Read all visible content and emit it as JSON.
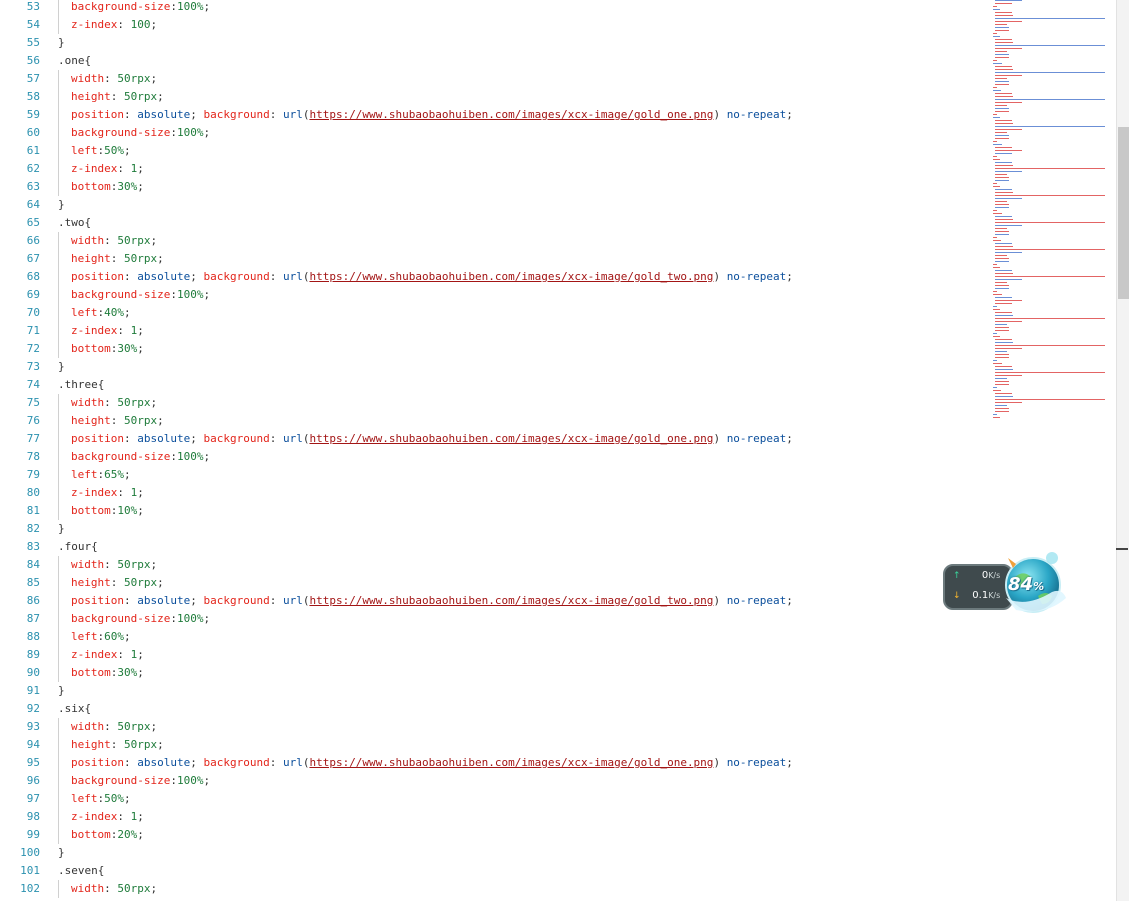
{
  "editor": {
    "lines": [
      {
        "n": "53",
        "indent": true,
        "tokens": [
          [
            "prop",
            "background-size"
          ],
          [
            "punct",
            ":"
          ],
          [
            "num",
            "100%"
          ],
          [
            "punct",
            ";"
          ]
        ]
      },
      {
        "n": "54",
        "indent": true,
        "tokens": [
          [
            "prop",
            "z-index"
          ],
          [
            "punct",
            ": "
          ],
          [
            "num",
            "100"
          ],
          [
            "punct",
            ";"
          ]
        ]
      },
      {
        "n": "55",
        "indent": false,
        "tokens": [
          [
            "brace",
            "}"
          ]
        ]
      },
      {
        "n": "56",
        "indent": false,
        "tokens": [
          [
            "sel",
            ".one"
          ],
          [
            "brace",
            "{"
          ]
        ]
      },
      {
        "n": "57",
        "indent": true,
        "tokens": [
          [
            "prop",
            "width"
          ],
          [
            "punct",
            ": "
          ],
          [
            "num",
            "50rpx"
          ],
          [
            "punct",
            ";"
          ]
        ]
      },
      {
        "n": "58",
        "indent": true,
        "tokens": [
          [
            "prop",
            "height"
          ],
          [
            "punct",
            ": "
          ],
          [
            "num",
            "50rpx"
          ],
          [
            "punct",
            ";"
          ]
        ]
      },
      {
        "n": "59",
        "indent": true,
        "tokens": [
          [
            "prop",
            "position"
          ],
          [
            "punct",
            ": "
          ],
          [
            "val",
            "absolute"
          ],
          [
            "punct",
            "; "
          ],
          [
            "prop",
            "background"
          ],
          [
            "punct",
            ": "
          ],
          [
            "fn",
            "url"
          ],
          [
            "punct",
            "("
          ],
          [
            "url",
            "https://www.shubaobaohuiben.com/images/xcx-image/gold_one.png"
          ],
          [
            "punct",
            ") "
          ],
          [
            "val",
            "no-repeat"
          ],
          [
            "punct",
            ";"
          ]
        ]
      },
      {
        "n": "60",
        "indent": true,
        "tokens": [
          [
            "prop",
            "background-size"
          ],
          [
            "punct",
            ":"
          ],
          [
            "num",
            "100%"
          ],
          [
            "punct",
            ";"
          ]
        ]
      },
      {
        "n": "61",
        "indent": true,
        "tokens": [
          [
            "prop",
            "left"
          ],
          [
            "punct",
            ":"
          ],
          [
            "num",
            "50%"
          ],
          [
            "punct",
            ";"
          ]
        ]
      },
      {
        "n": "62",
        "indent": true,
        "tokens": [
          [
            "prop",
            "z-index"
          ],
          [
            "punct",
            ": "
          ],
          [
            "num",
            "1"
          ],
          [
            "punct",
            ";"
          ]
        ]
      },
      {
        "n": "63",
        "indent": true,
        "tokens": [
          [
            "prop",
            "bottom"
          ],
          [
            "punct",
            ":"
          ],
          [
            "num",
            "30%"
          ],
          [
            "punct",
            ";"
          ]
        ]
      },
      {
        "n": "64",
        "indent": false,
        "tokens": [
          [
            "brace",
            "}"
          ]
        ]
      },
      {
        "n": "65",
        "indent": false,
        "tokens": [
          [
            "sel",
            ".two"
          ],
          [
            "brace",
            "{"
          ]
        ]
      },
      {
        "n": "66",
        "indent": true,
        "tokens": [
          [
            "prop",
            "width"
          ],
          [
            "punct",
            ": "
          ],
          [
            "num",
            "50rpx"
          ],
          [
            "punct",
            ";"
          ]
        ]
      },
      {
        "n": "67",
        "indent": true,
        "tokens": [
          [
            "prop",
            "height"
          ],
          [
            "punct",
            ": "
          ],
          [
            "num",
            "50rpx"
          ],
          [
            "punct",
            ";"
          ]
        ]
      },
      {
        "n": "68",
        "indent": true,
        "tokens": [
          [
            "prop",
            "position"
          ],
          [
            "punct",
            ": "
          ],
          [
            "val",
            "absolute"
          ],
          [
            "punct",
            "; "
          ],
          [
            "prop",
            "background"
          ],
          [
            "punct",
            ": "
          ],
          [
            "fn",
            "url"
          ],
          [
            "punct",
            "("
          ],
          [
            "url",
            "https://www.shubaobaohuiben.com/images/xcx-image/gold_two.png"
          ],
          [
            "punct",
            ") "
          ],
          [
            "val",
            "no-repeat"
          ],
          [
            "punct",
            ";"
          ]
        ]
      },
      {
        "n": "69",
        "indent": true,
        "tokens": [
          [
            "prop",
            "background-size"
          ],
          [
            "punct",
            ":"
          ],
          [
            "num",
            "100%"
          ],
          [
            "punct",
            ";"
          ]
        ]
      },
      {
        "n": "70",
        "indent": true,
        "tokens": [
          [
            "prop",
            "left"
          ],
          [
            "punct",
            ":"
          ],
          [
            "num",
            "40%"
          ],
          [
            "punct",
            ";"
          ]
        ]
      },
      {
        "n": "71",
        "indent": true,
        "tokens": [
          [
            "prop",
            "z-index"
          ],
          [
            "punct",
            ": "
          ],
          [
            "num",
            "1"
          ],
          [
            "punct",
            ";"
          ]
        ]
      },
      {
        "n": "72",
        "indent": true,
        "tokens": [
          [
            "prop",
            "bottom"
          ],
          [
            "punct",
            ":"
          ],
          [
            "num",
            "30%"
          ],
          [
            "punct",
            ";"
          ]
        ]
      },
      {
        "n": "73",
        "indent": false,
        "tokens": [
          [
            "brace",
            "}"
          ]
        ]
      },
      {
        "n": "74",
        "indent": false,
        "tokens": [
          [
            "sel",
            ".three"
          ],
          [
            "brace",
            "{"
          ]
        ]
      },
      {
        "n": "75",
        "indent": true,
        "tokens": [
          [
            "prop",
            "width"
          ],
          [
            "punct",
            ": "
          ],
          [
            "num",
            "50rpx"
          ],
          [
            "punct",
            ";"
          ]
        ]
      },
      {
        "n": "76",
        "indent": true,
        "tokens": [
          [
            "prop",
            "height"
          ],
          [
            "punct",
            ": "
          ],
          [
            "num",
            "50rpx"
          ],
          [
            "punct",
            ";"
          ]
        ]
      },
      {
        "n": "77",
        "indent": true,
        "tokens": [
          [
            "prop",
            "position"
          ],
          [
            "punct",
            ": "
          ],
          [
            "val",
            "absolute"
          ],
          [
            "punct",
            "; "
          ],
          [
            "prop",
            "background"
          ],
          [
            "punct",
            ": "
          ],
          [
            "fn",
            "url"
          ],
          [
            "punct",
            "("
          ],
          [
            "url",
            "https://www.shubaobaohuiben.com/images/xcx-image/gold_one.png"
          ],
          [
            "punct",
            ") "
          ],
          [
            "val",
            "no-repeat"
          ],
          [
            "punct",
            ";"
          ]
        ]
      },
      {
        "n": "78",
        "indent": true,
        "tokens": [
          [
            "prop",
            "background-size"
          ],
          [
            "punct",
            ":"
          ],
          [
            "num",
            "100%"
          ],
          [
            "punct",
            ";"
          ]
        ]
      },
      {
        "n": "79",
        "indent": true,
        "tokens": [
          [
            "prop",
            "left"
          ],
          [
            "punct",
            ":"
          ],
          [
            "num",
            "65%"
          ],
          [
            "punct",
            ";"
          ]
        ]
      },
      {
        "n": "80",
        "indent": true,
        "tokens": [
          [
            "prop",
            "z-index"
          ],
          [
            "punct",
            ": "
          ],
          [
            "num",
            "1"
          ],
          [
            "punct",
            ";"
          ]
        ]
      },
      {
        "n": "81",
        "indent": true,
        "tokens": [
          [
            "prop",
            "bottom"
          ],
          [
            "punct",
            ":"
          ],
          [
            "num",
            "10%"
          ],
          [
            "punct",
            ";"
          ]
        ]
      },
      {
        "n": "82",
        "indent": false,
        "tokens": [
          [
            "brace",
            "}"
          ]
        ]
      },
      {
        "n": "83",
        "indent": false,
        "tokens": [
          [
            "sel",
            ".four"
          ],
          [
            "brace",
            "{"
          ]
        ]
      },
      {
        "n": "84",
        "indent": true,
        "tokens": [
          [
            "prop",
            "width"
          ],
          [
            "punct",
            ": "
          ],
          [
            "num",
            "50rpx"
          ],
          [
            "punct",
            ";"
          ]
        ]
      },
      {
        "n": "85",
        "indent": true,
        "tokens": [
          [
            "prop",
            "height"
          ],
          [
            "punct",
            ": "
          ],
          [
            "num",
            "50rpx"
          ],
          [
            "punct",
            ";"
          ]
        ]
      },
      {
        "n": "86",
        "indent": true,
        "tokens": [
          [
            "prop",
            "position"
          ],
          [
            "punct",
            ": "
          ],
          [
            "val",
            "absolute"
          ],
          [
            "punct",
            "; "
          ],
          [
            "prop",
            "background"
          ],
          [
            "punct",
            ": "
          ],
          [
            "fn",
            "url"
          ],
          [
            "punct",
            "("
          ],
          [
            "url",
            "https://www.shubaobaohuiben.com/images/xcx-image/gold_two.png"
          ],
          [
            "punct",
            ") "
          ],
          [
            "val",
            "no-repeat"
          ],
          [
            "punct",
            ";"
          ]
        ]
      },
      {
        "n": "87",
        "indent": true,
        "tokens": [
          [
            "prop",
            "background-size"
          ],
          [
            "punct",
            ":"
          ],
          [
            "num",
            "100%"
          ],
          [
            "punct",
            ";"
          ]
        ]
      },
      {
        "n": "88",
        "indent": true,
        "tokens": [
          [
            "prop",
            "left"
          ],
          [
            "punct",
            ":"
          ],
          [
            "num",
            "60%"
          ],
          [
            "punct",
            ";"
          ]
        ]
      },
      {
        "n": "89",
        "indent": true,
        "tokens": [
          [
            "prop",
            "z-index"
          ],
          [
            "punct",
            ": "
          ],
          [
            "num",
            "1"
          ],
          [
            "punct",
            ";"
          ]
        ]
      },
      {
        "n": "90",
        "indent": true,
        "tokens": [
          [
            "prop",
            "bottom"
          ],
          [
            "punct",
            ":"
          ],
          [
            "num",
            "30%"
          ],
          [
            "punct",
            ";"
          ]
        ]
      },
      {
        "n": "91",
        "indent": false,
        "tokens": [
          [
            "brace",
            "}"
          ]
        ]
      },
      {
        "n": "92",
        "indent": false,
        "tokens": [
          [
            "sel",
            ".six"
          ],
          [
            "brace",
            "{"
          ]
        ]
      },
      {
        "n": "93",
        "indent": true,
        "tokens": [
          [
            "prop",
            "width"
          ],
          [
            "punct",
            ": "
          ],
          [
            "num",
            "50rpx"
          ],
          [
            "punct",
            ";"
          ]
        ]
      },
      {
        "n": "94",
        "indent": true,
        "tokens": [
          [
            "prop",
            "height"
          ],
          [
            "punct",
            ": "
          ],
          [
            "num",
            "50rpx"
          ],
          [
            "punct",
            ";"
          ]
        ]
      },
      {
        "n": "95",
        "indent": true,
        "tokens": [
          [
            "prop",
            "position"
          ],
          [
            "punct",
            ": "
          ],
          [
            "val",
            "absolute"
          ],
          [
            "punct",
            "; "
          ],
          [
            "prop",
            "background"
          ],
          [
            "punct",
            ": "
          ],
          [
            "fn",
            "url"
          ],
          [
            "punct",
            "("
          ],
          [
            "url",
            "https://www.shubaobaohuiben.com/images/xcx-image/gold_one.png"
          ],
          [
            "punct",
            ") "
          ],
          [
            "val",
            "no-repeat"
          ],
          [
            "punct",
            ";"
          ]
        ]
      },
      {
        "n": "96",
        "indent": true,
        "tokens": [
          [
            "prop",
            "background-size"
          ],
          [
            "punct",
            ":"
          ],
          [
            "num",
            "100%"
          ],
          [
            "punct",
            ";"
          ]
        ]
      },
      {
        "n": "97",
        "indent": true,
        "tokens": [
          [
            "prop",
            "left"
          ],
          [
            "punct",
            ":"
          ],
          [
            "num",
            "50%"
          ],
          [
            "punct",
            ";"
          ]
        ]
      },
      {
        "n": "98",
        "indent": true,
        "tokens": [
          [
            "prop",
            "z-index"
          ],
          [
            "punct",
            ": "
          ],
          [
            "num",
            "1"
          ],
          [
            "punct",
            ";"
          ]
        ]
      },
      {
        "n": "99",
        "indent": true,
        "tokens": [
          [
            "prop",
            "bottom"
          ],
          [
            "punct",
            ":"
          ],
          [
            "num",
            "20%"
          ],
          [
            "punct",
            ";"
          ]
        ]
      },
      {
        "n": "100",
        "indent": false,
        "tokens": [
          [
            "brace",
            "}"
          ]
        ]
      },
      {
        "n": "101",
        "indent": false,
        "tokens": [
          [
            "sel",
            ".seven"
          ],
          [
            "brace",
            "{"
          ]
        ]
      },
      {
        "n": "102",
        "indent": true,
        "tokens": [
          [
            "prop",
            "width"
          ],
          [
            "punct",
            ": "
          ],
          [
            "num",
            "50rpx"
          ],
          [
            "punct",
            ";"
          ]
        ]
      }
    ]
  },
  "net_widget": {
    "upload_value": "0",
    "upload_unit": "K/s",
    "download_value": "0.1",
    "download_unit": "K/s",
    "percent": "84",
    "percent_sign": "%",
    "upload_icon": "arrow-up-icon",
    "download_icon": "arrow-down-icon"
  },
  "scrollbar": {
    "position_fraction": 0.14
  },
  "colors": {
    "line_number": "#2b91af",
    "property": "#e3251b",
    "value": "#0b4f9c",
    "number": "#1e7b3a",
    "url": "#a31515"
  }
}
